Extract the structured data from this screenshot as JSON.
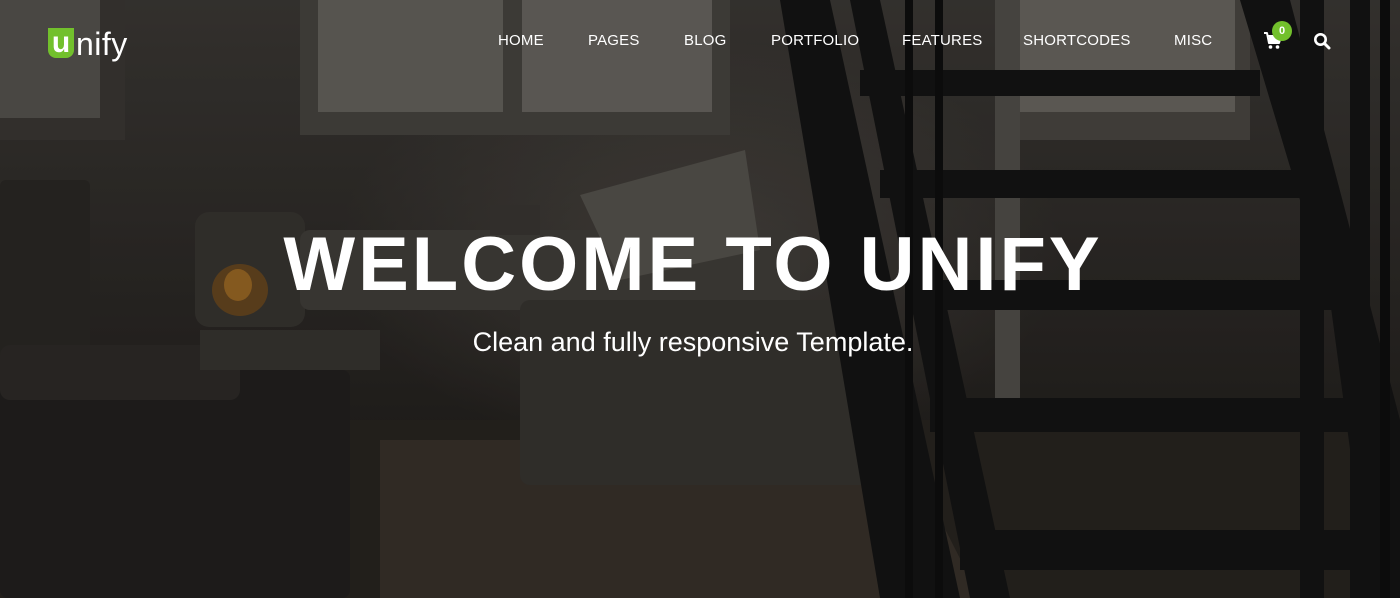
{
  "brand": {
    "logo_initial": "u",
    "logo_rest": "nify",
    "accent_color": "#72c02c"
  },
  "nav": {
    "items": [
      {
        "label": "HOME"
      },
      {
        "label": "PAGES"
      },
      {
        "label": "BLOG"
      },
      {
        "label": "PORTFOLIO"
      },
      {
        "label": "FEATURES"
      },
      {
        "label": "SHORTCODES"
      },
      {
        "label": "MISC"
      }
    ],
    "cart": {
      "icon": "shopping-cart-icon",
      "count": "0"
    },
    "search": {
      "icon": "search-icon"
    }
  },
  "hero": {
    "title": "WELCOME TO UNIFY",
    "subtitle": "Clean and fully responsive Template.",
    "background": "dark living-room-photo"
  }
}
